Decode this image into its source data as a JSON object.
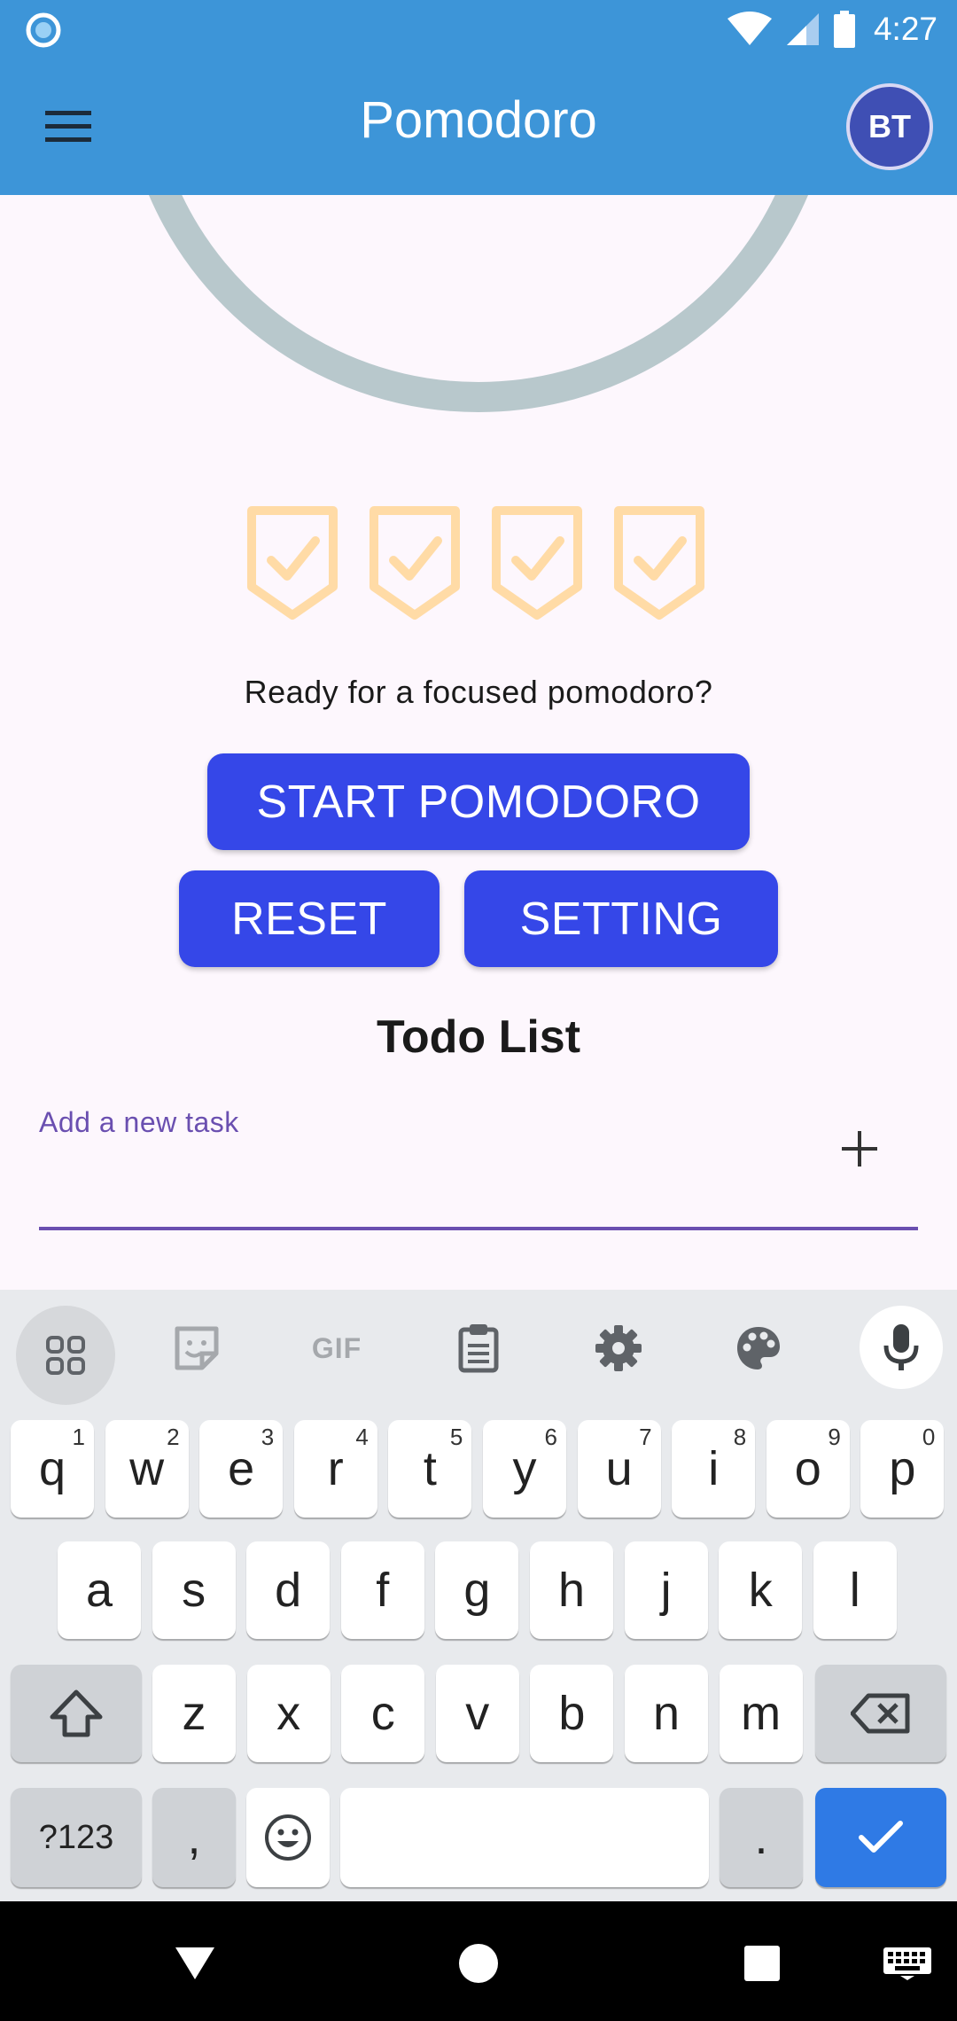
{
  "status_bar": {
    "time": "4:27",
    "icons": [
      "notification-dot-icon",
      "wifi-icon",
      "signal-icon",
      "battery-icon"
    ]
  },
  "app_bar": {
    "title": "Pomodoro",
    "avatar_initials": "BT",
    "menu_icon": "hamburger-menu-icon"
  },
  "timer": {
    "ring_color": "#b8c8cc",
    "completed_sessions": 4,
    "session_icon": "shield-check-icon",
    "session_icon_color": "#ffdba6"
  },
  "main": {
    "status_message": "Ready for a focused pomodoro?",
    "start_label": "START POMODORO",
    "reset_label": "RESET",
    "setting_label": "SETTING"
  },
  "todo": {
    "title": "Todo List",
    "input_label": "Add a new task",
    "input_value": "",
    "add_icon": "plus-icon"
  },
  "keyboard": {
    "toolbar": {
      "gif_label": "GIF",
      "icons": [
        "apps-grid-icon",
        "sticker-icon",
        "gif-icon",
        "clipboard-icon",
        "gear-icon",
        "palette-icon",
        "microphone-icon"
      ]
    },
    "row1": [
      {
        "k": "q",
        "s": "1"
      },
      {
        "k": "w",
        "s": "2"
      },
      {
        "k": "e",
        "s": "3"
      },
      {
        "k": "r",
        "s": "4"
      },
      {
        "k": "t",
        "s": "5"
      },
      {
        "k": "y",
        "s": "6"
      },
      {
        "k": "u",
        "s": "7"
      },
      {
        "k": "i",
        "s": "8"
      },
      {
        "k": "o",
        "s": "9"
      },
      {
        "k": "p",
        "s": "0"
      }
    ],
    "row2": [
      "a",
      "s",
      "d",
      "f",
      "g",
      "h",
      "j",
      "k",
      "l"
    ],
    "row3": [
      "z",
      "x",
      "c",
      "v",
      "b",
      "n",
      "m"
    ],
    "symbols_label": "?123",
    "comma_label": ",",
    "period_label": "."
  },
  "colors": {
    "app_bar": "#3d95d8",
    "button": "#3547e8",
    "accent": "#6a4fb0",
    "avatar": "#3f4fb4"
  }
}
